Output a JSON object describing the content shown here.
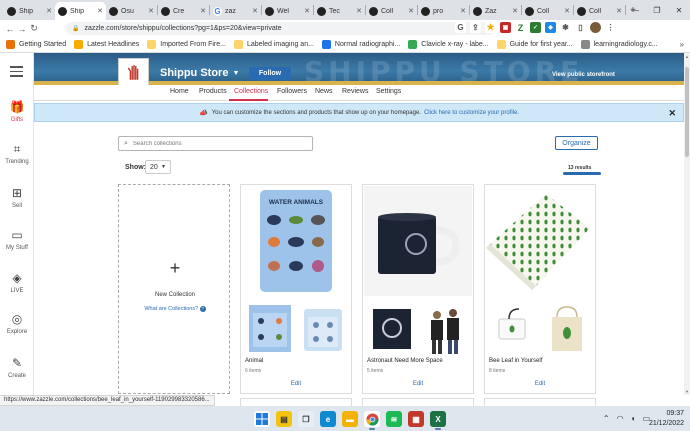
{
  "browser": {
    "tabs": [
      {
        "label": "Ship",
        "color": "#222222"
      },
      {
        "label": "Ship",
        "color": "#222222",
        "active": true
      },
      {
        "label": "Osu",
        "color": "#222222"
      },
      {
        "label": "Cre",
        "color": "#222222"
      },
      {
        "label": "zaz",
        "color": "#4285f4",
        "glyph": "G"
      },
      {
        "label": "Wel",
        "color": "#222222"
      },
      {
        "label": "Tec",
        "color": "#222222"
      },
      {
        "label": "Coll",
        "color": "#222222"
      },
      {
        "label": "pro",
        "color": "#222222"
      },
      {
        "label": "Zaz",
        "color": "#222222"
      },
      {
        "label": "Coll",
        "color": "#222222"
      },
      {
        "label": "Coll",
        "color": "#222222"
      }
    ],
    "new_tab": "+",
    "url": "zazzle.com/store/shippu/collections?pg=1&ps=20&view=private",
    "bookmarks": [
      {
        "label": "Getting Started",
        "color": "#e8710a"
      },
      {
        "label": "Latest Headlines",
        "color": "#f9ab00"
      },
      {
        "label": "Imported From Fire...",
        "color": "#f9d56a"
      },
      {
        "label": "Labeled imaging an...",
        "color": "#f9d56a"
      },
      {
        "label": "Normal radiographi...",
        "color": "#1a73e8"
      },
      {
        "label": "Clavicle x-ray - labe...",
        "color": "#34a853"
      },
      {
        "label": "Guide for first year...",
        "color": "#f9d56a"
      },
      {
        "label": "learningradiology.c...",
        "color": "#888888"
      }
    ],
    "bookmarks_more": "»"
  },
  "sidebar": {
    "items": [
      {
        "label": "Gifts",
        "icon": "gift-icon",
        "glyph": "🎁"
      },
      {
        "label": "Trending",
        "icon": "trending-icon",
        "glyph": "⌗"
      },
      {
        "label": "Sell",
        "icon": "sell-icon",
        "glyph": "⊞"
      },
      {
        "label": "My Stuff",
        "icon": "folder-icon",
        "glyph": "▭"
      },
      {
        "label": "LIVE",
        "icon": "live-icon",
        "glyph": "◈"
      },
      {
        "label": "Explore",
        "icon": "explore-icon",
        "glyph": "◎"
      },
      {
        "label": "Create",
        "icon": "pen-icon",
        "glyph": "✎"
      }
    ]
  },
  "store": {
    "banner_text": "SHIPPU STORE",
    "logo_text": "Shippu Store",
    "name": "Shippu Store",
    "follow": "Follow",
    "view_public": "View public storefront",
    "nav": [
      "Home",
      "Products",
      "Collections",
      "Followers",
      "News",
      "Reviews",
      "Settings"
    ]
  },
  "notice": {
    "text": "You can customize the sections and products that show up on your homepage.",
    "link": "Click here to customize your profile."
  },
  "controls": {
    "search_placeholder": "Search collections",
    "organize": "Organize",
    "show_label": "Show:",
    "show_value": "20",
    "results": "13 results"
  },
  "new_collection": {
    "label": "New Collection",
    "link": "What are Collections?"
  },
  "collections": [
    {
      "title": "Animal",
      "count": "6 items",
      "edit": "Edit",
      "main": "blanket",
      "poster_title": "WATER ANIMALS"
    },
    {
      "title": "Astronaut Need More Space",
      "count": "5 items",
      "edit": "Edit",
      "main": "mug"
    },
    {
      "title": "Bee Leaf in Yourself",
      "count": "8 items",
      "edit": "Edit",
      "main": "wrap"
    }
  ],
  "status_url": "https://www.zazzle.com/collections/bee_leaf_in_yourself-119029983320586...",
  "taskbar": {
    "time": "09:37",
    "date": "21/12/2022"
  }
}
